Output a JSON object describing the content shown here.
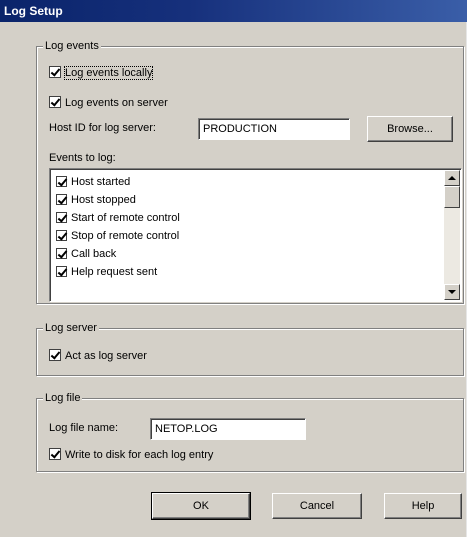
{
  "window": {
    "title": "Log Setup"
  },
  "log_events": {
    "group_label": "Log events",
    "log_locally_label": "Log events locally",
    "log_locally_checked": true,
    "log_on_server_label": "Log events on server",
    "log_on_server_checked": true,
    "host_id_label": "Host ID for log server:",
    "host_id_value": "PRODUCTION",
    "browse_label": "Browse...",
    "events_to_log_label": "Events to log:",
    "events": [
      {
        "label": "Host started",
        "checked": true
      },
      {
        "label": "Host stopped",
        "checked": true
      },
      {
        "label": "Start of remote control",
        "checked": true
      },
      {
        "label": "Stop of remote control",
        "checked": true
      },
      {
        "label": "Call back",
        "checked": true
      },
      {
        "label": "Help request sent",
        "checked": true
      }
    ]
  },
  "log_server": {
    "group_label": "Log server",
    "act_as_server_label": "Act as log server",
    "act_as_server_checked": true
  },
  "log_file": {
    "group_label": "Log file",
    "file_name_label": "Log file name:",
    "file_name_value": "NETOP.LOG",
    "write_each_label": "Write to disk for each log entry",
    "write_each_checked": true
  },
  "buttons": {
    "ok": "OK",
    "cancel": "Cancel",
    "help": "Help"
  }
}
